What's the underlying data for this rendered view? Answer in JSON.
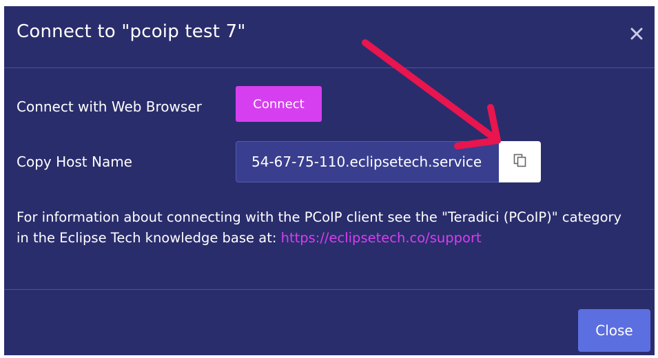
{
  "dialog": {
    "title": "Connect to \"pcoip test 7\"",
    "close_icon": "close-icon"
  },
  "web_browser": {
    "label": "Connect with Web Browser",
    "button_label": "Connect",
    "button_color": "#d63ff0"
  },
  "host": {
    "label": "Copy Host Name",
    "value": "54-67-75-110.eclipsetech.service",
    "copy_icon": "copy-icon"
  },
  "info": {
    "text": "For information about connecting with the PCoIP client see the \"Teradici (PCoIP)\" category in the Eclipse Tech knowledge base at: ",
    "link_text": "https://eclipsetech.co/support",
    "link_color": "#d63ff0"
  },
  "footer": {
    "close_label": "Close",
    "close_color": "#5b6fe0"
  },
  "annotation": {
    "color": "#e8154f",
    "icon": "arrow-icon"
  }
}
